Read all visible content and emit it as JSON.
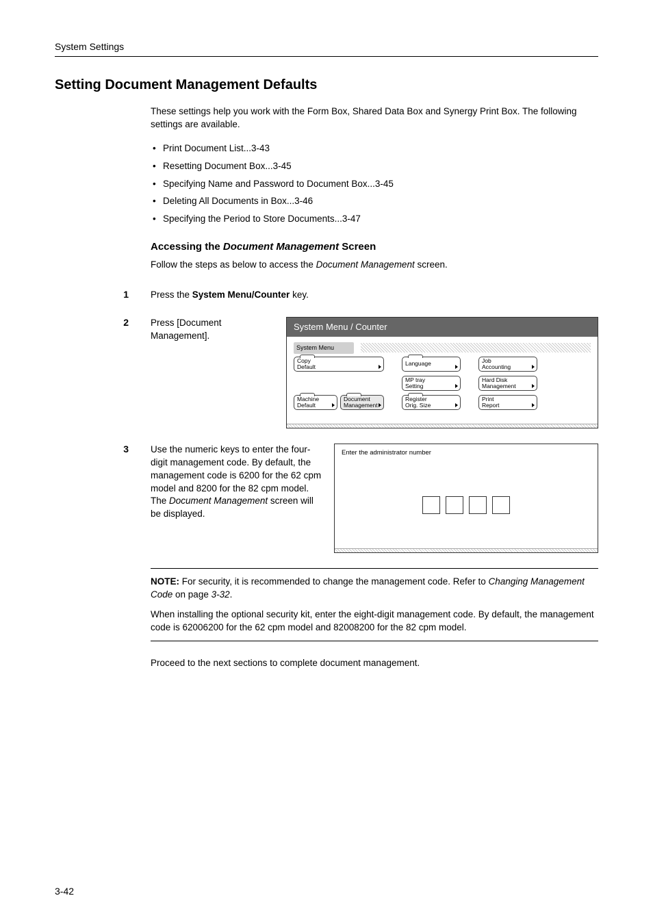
{
  "header": "System Settings",
  "title": "Setting Document Management Defaults",
  "intro": "These settings help you work with the Form Box, Shared Data Box and Synergy Print Box. The following settings are available.",
  "bullets": [
    "Print Document List...3-43",
    "Resetting Document Box...3-45",
    "Specifying Name and Password to Document Box...3-45",
    "Deleting All Documents in Box...3-46",
    "Specifying the Period to Store Documents...3-47"
  ],
  "subheading": {
    "pre": "Accessing the ",
    "ital": "Document Management",
    "post": " Screen"
  },
  "follow": {
    "pre": "Follow the steps as below to access the ",
    "ital": "Document Management",
    "post": " screen."
  },
  "steps": {
    "s1": {
      "num": "1",
      "pre": "Press the ",
      "bold": "System Menu/Counter",
      "post": " key."
    },
    "s2": {
      "num": "2",
      "text": "Press [Document Management]."
    },
    "s3": {
      "num": "3",
      "pre": "Use the numeric keys to enter the four-digit management code. By default, the management code is 6200 for the 62 cpm model and 8200 for the 82 cpm model. The ",
      "ital": "Document Management",
      "post": " screen will be displayed."
    }
  },
  "panel": {
    "title": "System Menu / Counter",
    "label": "System Menu",
    "btn_copy_default": "Copy\nDefault",
    "btn_language": "Language",
    "btn_job_accounting": "Job\nAccounting",
    "btn_mp_tray": "MP tray\nSetting",
    "btn_hard_disk": "Hard Disk\nManagement",
    "btn_machine_default": "Machine\nDefault",
    "btn_doc_mgmt": "Document\nManagement",
    "btn_register": "Register\nOrig. Size",
    "btn_print_report": "Print\nReport"
  },
  "admin_panel": {
    "label": "Enter the administrator number"
  },
  "note": {
    "bold": "NOTE:",
    "p1_pre": " For security, it is recommended to change the management code. Refer to ",
    "p1_ital": "Changing Management Code",
    "p1_post": " on page ",
    "p1_ital2": "3-32",
    "p1_end": ".",
    "p2": "When installing the optional security kit, enter the eight-digit management code. By default, the management code is 62006200 for the 62 cpm model and 82008200 for the 82 cpm model."
  },
  "proceed": "Proceed to the next sections to complete document management.",
  "page_number": "3-42"
}
